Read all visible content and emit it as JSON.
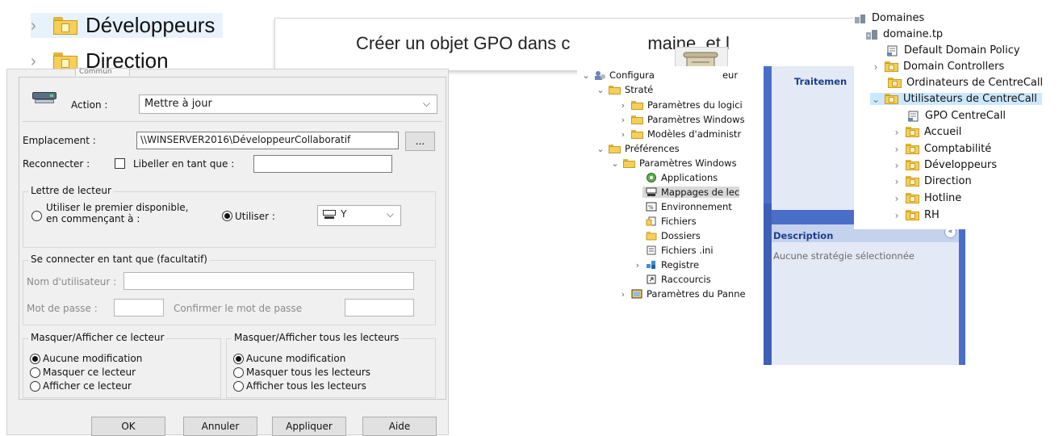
{
  "top_tree": {
    "items": [
      {
        "label": "Développeurs"
      },
      {
        "label": "Direction"
      }
    ]
  },
  "banner": {
    "text": "Créer un objet GPO dans c",
    "text_tail": "maine, et l"
  },
  "dialog": {
    "tab_label": "Commun",
    "action_label": "Action :",
    "action_value": "Mettre à jour",
    "location_label": "Emplacement :",
    "location_value": "\\\\WINSERVER2016\\DéveloppeurCollaboratif",
    "browse_label": "...",
    "reconnect_label": "Reconnecter :",
    "label_as_label": "Libeller en tant que :",
    "label_as_value": "",
    "drive_letter_group": "Lettre de lecteur",
    "first_available_label_line1": "Utiliser le premier disponible,",
    "first_available_label_line2": "en commençant à :",
    "use_label": "Utiliser :",
    "drive_letter_value": "Y",
    "connect_as_group": "Se connecter en tant que (facultatif)",
    "username_label": "Nom d'utilisateur :",
    "password_label": "Mot de passe :",
    "confirm_password_label": "Confirmer le mot de passe",
    "hide_show_this_group": "Masquer/Afficher ce lecteur",
    "hide_show_this_options": [
      "Aucune modification",
      "Masquer ce lecteur",
      "Afficher ce lecteur"
    ],
    "hide_show_all_group": "Masquer/Afficher tous les lecteurs",
    "hide_show_all_options": [
      "Aucune modification",
      "Masquer tous les lecteurs",
      "Afficher tous les lecteurs"
    ],
    "buttons": {
      "ok": "OK",
      "cancel": "Annuler",
      "apply": "Appliquer",
      "help": "Aide"
    }
  },
  "editor_tree": {
    "rows": [
      {
        "label": "Configura",
        "label_tail": "eur"
      },
      {
        "label": "Straté"
      },
      {
        "label": "Paramètres du logici"
      },
      {
        "label": "Paramètres Windows"
      },
      {
        "label": "Modèles d'administr"
      },
      {
        "label": "Préférences"
      },
      {
        "label": "Paramètres Windows"
      },
      {
        "label": "Applications"
      },
      {
        "label": "Mappages de lec"
      },
      {
        "label": "Environnement"
      },
      {
        "label": "Fichiers"
      },
      {
        "label": "Dossiers"
      },
      {
        "label": "Fichiers .ini"
      },
      {
        "label": "Registre"
      },
      {
        "label": "Raccourcis"
      },
      {
        "label": "Paramètres du Panne"
      }
    ]
  },
  "side_pane": {
    "processing_heading": "Traitemen",
    "description_heading": "Description",
    "description_text": "Aucune stratégie sélectionnée",
    "collapse_glyph": "«"
  },
  "domain_tree": {
    "rows": [
      {
        "label": "Domaines"
      },
      {
        "label": "domaine.tp"
      },
      {
        "label": "Default Domain Policy"
      },
      {
        "label": "Domain Controllers"
      },
      {
        "label": "Ordinateurs de CentreCall"
      },
      {
        "label": "Utilisateurs de CentreCall"
      },
      {
        "label": "GPO CentreCall"
      },
      {
        "label": "Accueil"
      },
      {
        "label": "Comptabilité"
      },
      {
        "label": "Développeurs"
      },
      {
        "label": "Direction"
      },
      {
        "label": "Hotline"
      },
      {
        "label": "RH"
      }
    ]
  },
  "colors": {
    "selection": "#cce8ff",
    "pane_blue": "#4a6ec8",
    "folder_yellow": "#f4cf5a"
  }
}
